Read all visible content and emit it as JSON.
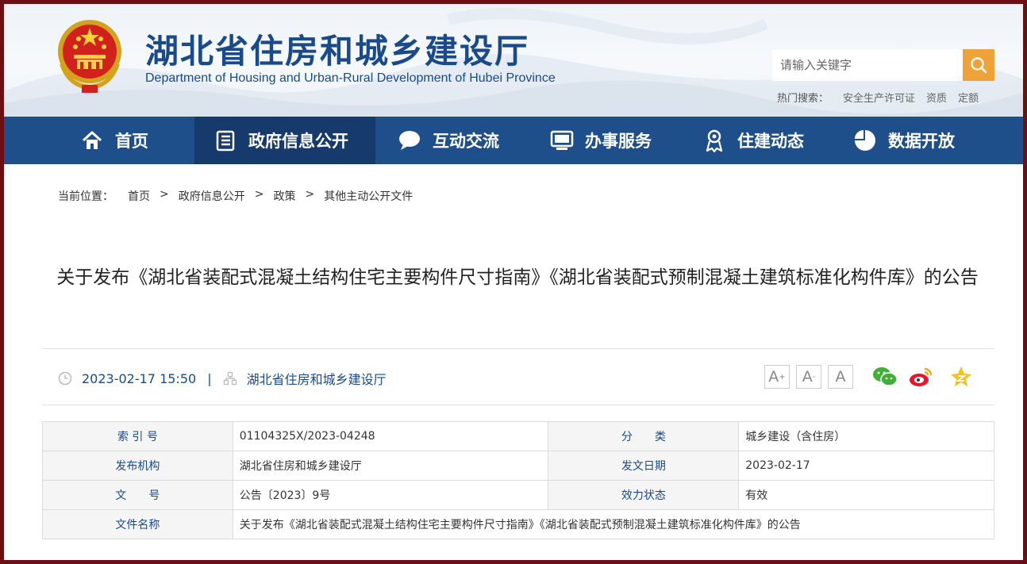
{
  "header": {
    "title": "湖北省住房和城乡建设厅",
    "subtitle": "Department of Housing and Urban-Rural Development of Hubei Province",
    "search_placeholder": "请输入关键字",
    "hot_label": "热门搜索：",
    "hot_keywords": [
      "安全生产许可证",
      "资质",
      "定额"
    ]
  },
  "nav": [
    {
      "label": "首页",
      "icon": "home-icon"
    },
    {
      "label": "政府信息公开",
      "icon": "document-list-icon"
    },
    {
      "label": "互动交流",
      "icon": "chat-bubble-icon"
    },
    {
      "label": "办事服务",
      "icon": "monitor-icon"
    },
    {
      "label": "住建动态",
      "icon": "person-badge-icon"
    },
    {
      "label": "数据开放",
      "icon": "pie-chart-icon"
    }
  ],
  "breadcrumb": {
    "label": "当前位置：",
    "items": [
      "首页",
      "政府信息公开",
      "政策",
      "其他主动公开文件"
    ],
    "separator": ">"
  },
  "article": {
    "title": "关于发布《湖北省装配式混凝土结构住宅主要构件尺寸指南》《湖北省装配式预制混凝土建筑标准化构件库》的公告",
    "datetime": "2023-02-17 15:50",
    "meta_sep": "|",
    "source": "湖北省住房和城乡建设厅"
  },
  "font_size_buttons": [
    "A+",
    "A-",
    "A"
  ],
  "share_icons": [
    "wechat-icon",
    "weibo-icon",
    "favorite-star-icon"
  ],
  "info_table": {
    "rows": [
      {
        "k1": "索 引 号",
        "v1": "01104325X/2023-04248",
        "k2": "分　　类",
        "v2": "城乡建设（含住房）"
      },
      {
        "k1": "发布机构",
        "v1": "湖北省住房和城乡建设厅",
        "k2": "发文日期",
        "v2": "2023-02-17"
      },
      {
        "k1": "文　　号",
        "v1": "公告〔2023〕9号",
        "k2": "效力状态",
        "v2": "有效"
      }
    ],
    "name_row": {
      "k": "文件名称",
      "v": "关于发布《湖北省装配式混凝土结构住宅主要构件尺寸指南》《湖北省装配式预制混凝土建筑标准化构件库》的公告"
    }
  },
  "colors": {
    "brand_blue": "#1f4f8b",
    "nav_active": "#163a6b",
    "search_button": "#f0a23a",
    "frame": "#6b0f12"
  }
}
